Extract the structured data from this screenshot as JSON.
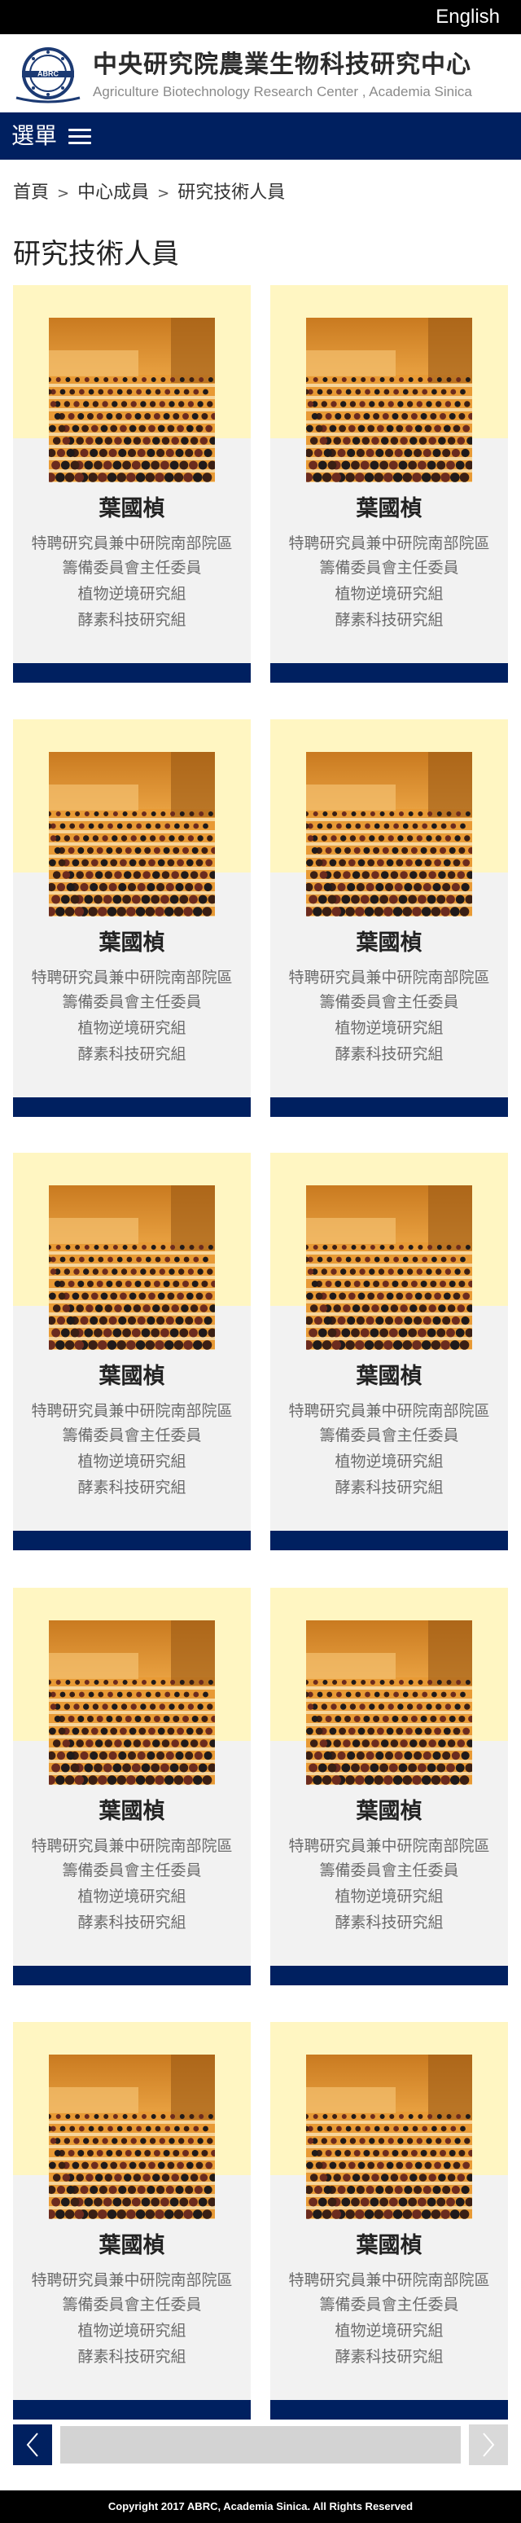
{
  "header": {
    "language_toggle": "English",
    "title": "中央研究院農業生物科技研究中心",
    "subtitle": "Agriculture Biotechnology Research Center , Academia Sinica",
    "logo_text": "ABRC"
  },
  "menu": {
    "label": "選單",
    "icon": "hamburger-menu-icon"
  },
  "breadcrumb": {
    "home": "首頁",
    "section": "中心成員",
    "current": "研究技術人員",
    "separator": ">"
  },
  "page_title": "研究技術人員",
  "cards": [
    {
      "name": "葉國楨",
      "title_1": "特聘研究員兼中研院南部院區",
      "title_2": "籌備委員會主任委員",
      "group_1": "植物逆境研究組",
      "group_2": "酵素科技研究組"
    },
    {
      "name": "葉國楨",
      "title_1": "特聘研究員兼中研院南部院區",
      "title_2": "籌備委員會主任委員",
      "group_1": "植物逆境研究組",
      "group_2": "酵素科技研究組"
    },
    {
      "name": "葉國楨",
      "title_1": "特聘研究員兼中研院南部院區",
      "title_2": "籌備委員會主任委員",
      "group_1": "植物逆境研究組",
      "group_2": "酵素科技研究組"
    },
    {
      "name": "葉國楨",
      "title_1": "特聘研究員兼中研院南部院區",
      "title_2": "籌備委員會主任委員",
      "group_1": "植物逆境研究組",
      "group_2": "酵素科技研究組"
    },
    {
      "name": "葉國楨",
      "title_1": "特聘研究員兼中研院南部院區",
      "title_2": "籌備委員會主任委員",
      "group_1": "植物逆境研究組",
      "group_2": "酵素科技研究組"
    },
    {
      "name": "葉國楨",
      "title_1": "特聘研究員兼中研院南部院區",
      "title_2": "籌備委員會主任委員",
      "group_1": "植物逆境研究組",
      "group_2": "酵素科技研究組"
    },
    {
      "name": "葉國楨",
      "title_1": "特聘研究員兼中研院南部院區",
      "title_2": "籌備委員會主任委員",
      "group_1": "植物逆境研究組",
      "group_2": "酵素科技研究組"
    },
    {
      "name": "葉國楨",
      "title_1": "特聘研究員兼中研院南部院區",
      "title_2": "籌備委員會主任委員",
      "group_1": "植物逆境研究組",
      "group_2": "酵素科技研究組"
    },
    {
      "name": "葉國楨",
      "title_1": "特聘研究員兼中研院南部院區",
      "title_2": "籌備委員會主任委員",
      "group_1": "植物逆境研究組",
      "group_2": "酵素科技研究組"
    },
    {
      "name": "葉國楨",
      "title_1": "特聘研究員兼中研院南部院區",
      "title_2": "籌備委員會主任委員",
      "group_1": "植物逆境研究組",
      "group_2": "酵素科技研究組"
    }
  ],
  "colors": {
    "navy": "#002060",
    "card_band": "#fff6c2",
    "card_bg": "#f2f2f2",
    "black": "#000000"
  },
  "footer": {
    "copyright": "Copyright 2017 ABRC, Academia Sinica. All Rights Reserved"
  }
}
